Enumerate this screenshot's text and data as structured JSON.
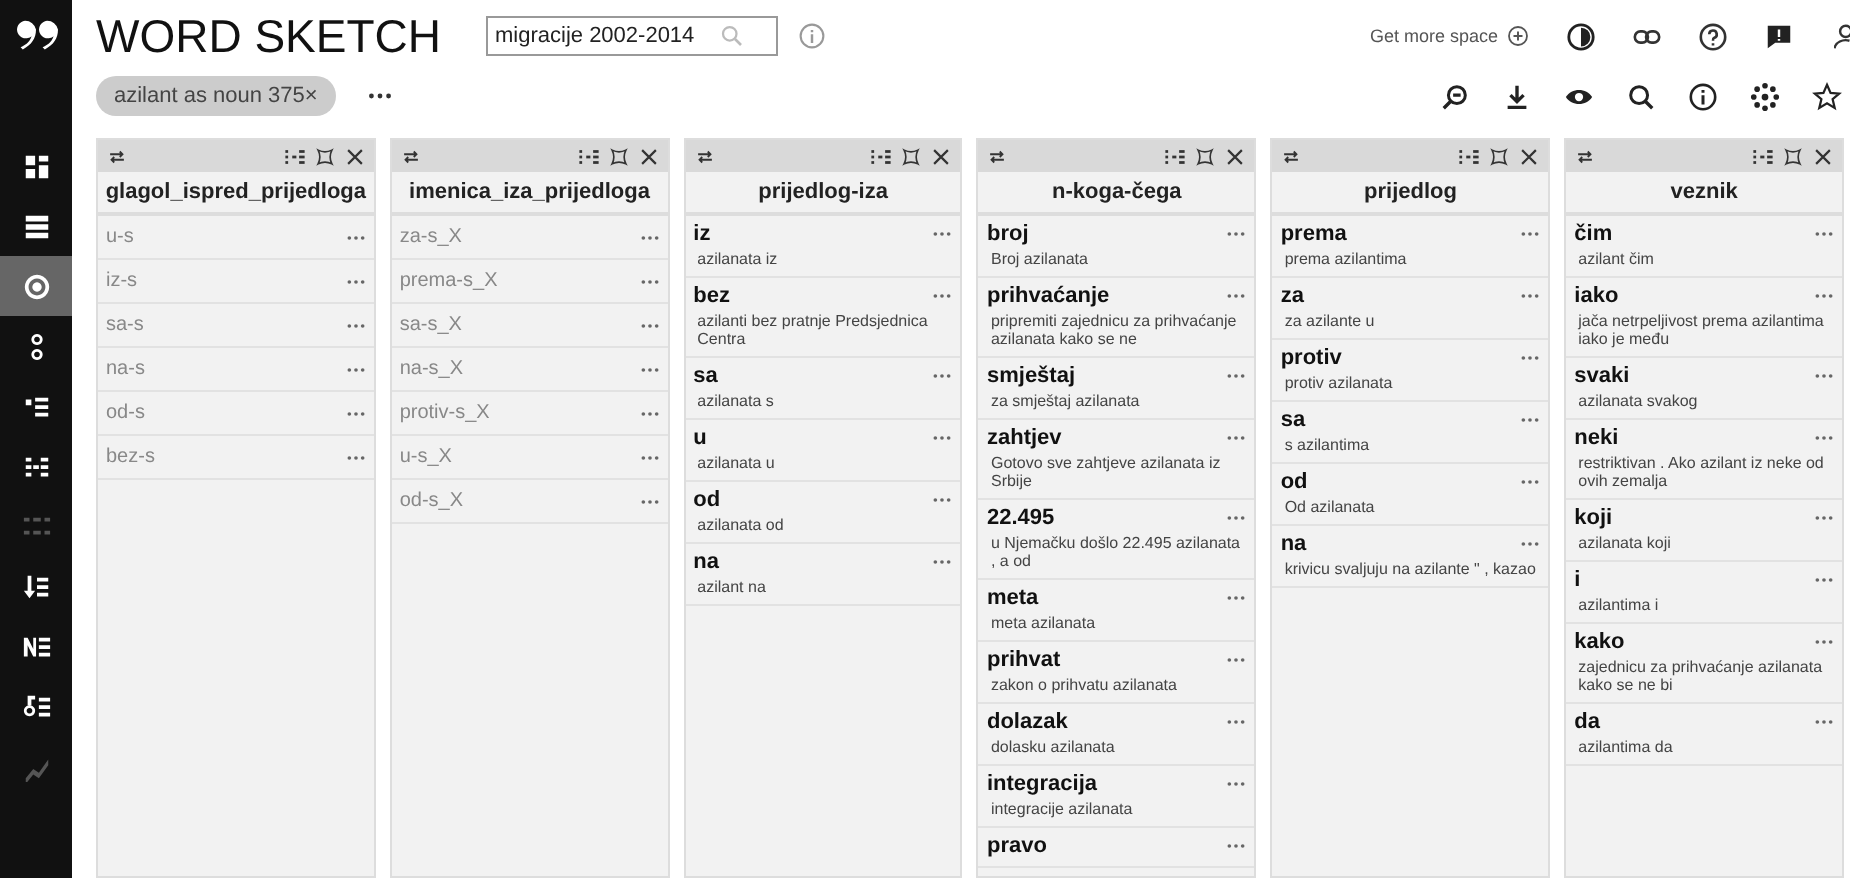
{
  "app_title": "WORD SKETCH",
  "corpus_field": {
    "value": "migracije 2002-2014"
  },
  "get_more_space": "Get more space",
  "query_chip": "azilant as noun 375×",
  "sidebar": [
    {
      "selected": false,
      "disabled": false
    },
    {
      "selected": false,
      "disabled": false
    },
    {
      "selected": true,
      "disabled": false
    },
    {
      "selected": false,
      "disabled": false
    },
    {
      "selected": false,
      "disabled": false
    },
    {
      "selected": false,
      "disabled": false
    },
    {
      "selected": false,
      "disabled": true
    },
    {
      "selected": false,
      "disabled": false
    },
    {
      "selected": false,
      "disabled": false
    },
    {
      "selected": false,
      "disabled": false
    },
    {
      "selected": false,
      "disabled": true
    }
  ],
  "columns": [
    {
      "title": "glagol_ispred_prijedloga",
      "kind": "plain",
      "items": [
        {
          "word": "u-s"
        },
        {
          "word": "iz-s"
        },
        {
          "word": "sa-s"
        },
        {
          "word": "na-s"
        },
        {
          "word": "od-s"
        },
        {
          "word": "bez-s"
        }
      ]
    },
    {
      "title": "imenica_iza_prijedloga",
      "kind": "plain",
      "items": [
        {
          "word": "za-s_X"
        },
        {
          "word": "prema-s_X"
        },
        {
          "word": "sa-s_X"
        },
        {
          "word": "na-s_X"
        },
        {
          "word": "protiv-s_X"
        },
        {
          "word": "u-s_X"
        },
        {
          "word": "od-s_X"
        }
      ]
    },
    {
      "title": "prijedlog-iza",
      "kind": "examples",
      "items": [
        {
          "word": "iz",
          "example": "azilanata iz"
        },
        {
          "word": "bez",
          "example": "azilanti bez pratnje Predsjednica Centra"
        },
        {
          "word": "sa",
          "example": "azilanata s"
        },
        {
          "word": "u",
          "example": "azilanata u"
        },
        {
          "word": "od",
          "example": "azilanata od"
        },
        {
          "word": "na",
          "example": "azilant na"
        }
      ]
    },
    {
      "title": "n-koga-čega",
      "kind": "examples",
      "items": [
        {
          "word": "broj",
          "example": "Broj azilanata"
        },
        {
          "word": "prihvaćanje",
          "example": "pripremiti zajednicu za prihvaćanje azilanata kako se ne"
        },
        {
          "word": "smještaj",
          "example": "za smještaj azilanata"
        },
        {
          "word": "zahtjev",
          "example": "Gotovo sve zahtjeve azilanata iz Srbije"
        },
        {
          "word": "22.495",
          "example": "u Njemačku došlo 22.495 azilanata , a od"
        },
        {
          "word": "meta",
          "example": "meta azilanata"
        },
        {
          "word": "prihvat",
          "example": "zakon o prihvatu azilanata"
        },
        {
          "word": "dolazak",
          "example": "dolasku azilanata"
        },
        {
          "word": "integracija",
          "example": "integracije azilanata"
        },
        {
          "word": "pravo"
        }
      ]
    },
    {
      "title": "prijedlog",
      "kind": "examples",
      "items": [
        {
          "word": "prema",
          "example": "prema azilantima"
        },
        {
          "word": "za",
          "example": "za azilante u"
        },
        {
          "word": "protiv",
          "example": "protiv azilanata"
        },
        {
          "word": "sa",
          "example": "s azilantima"
        },
        {
          "word": "od",
          "example": "Od azilanata"
        },
        {
          "word": "na",
          "example": "krivicu svaljuju na azilante \" , kazao"
        }
      ]
    },
    {
      "title": "veznik",
      "kind": "examples",
      "items": [
        {
          "word": "čim",
          "example": "azilant čim"
        },
        {
          "word": "iako",
          "example": "jača netrpeljivost prema azilantima iako je među"
        },
        {
          "word": "svaki",
          "example": "azilanata svakog"
        },
        {
          "word": "neki",
          "example": "restriktivan . Ako azilant iz neke od ovih zemalja"
        },
        {
          "word": "koji",
          "example": "azilanata koji"
        },
        {
          "word": "i",
          "example": "azilantima i"
        },
        {
          "word": "kako",
          "example": "zajednicu za prihvaćanje azilanata kako se ne bi"
        },
        {
          "word": "da",
          "example": "azilantima da"
        }
      ]
    }
  ]
}
